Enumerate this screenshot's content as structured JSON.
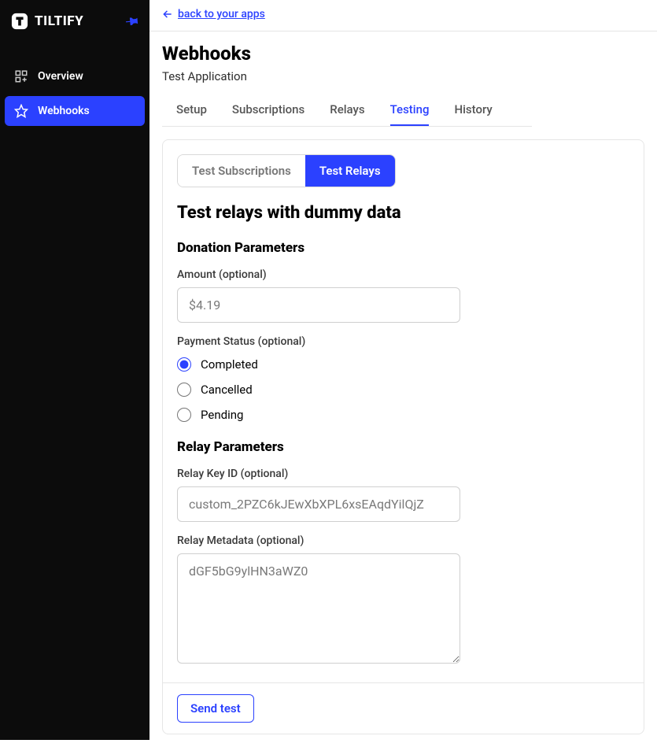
{
  "brand": {
    "name": "TILTIFY"
  },
  "sidebar": {
    "items": [
      {
        "label": "Overview",
        "active": false
      },
      {
        "label": "Webhooks",
        "active": true
      }
    ]
  },
  "backlink": "back to your apps",
  "header": {
    "title": "Webhooks",
    "subtitle": "Test Application"
  },
  "tabs": [
    {
      "label": "Setup",
      "active": false
    },
    {
      "label": "Subscriptions",
      "active": false
    },
    {
      "label": "Relays",
      "active": false
    },
    {
      "label": "Testing",
      "active": true
    },
    {
      "label": "History",
      "active": false
    }
  ],
  "subtabs": [
    {
      "label": "Test Subscriptions",
      "active": false
    },
    {
      "label": "Test Relays",
      "active": true
    }
  ],
  "section_title": "Test relays with dummy data",
  "donation": {
    "group_title": "Donation Parameters",
    "amount_label": "Amount (optional)",
    "amount_placeholder": "$4.19",
    "status_label": "Payment Status (optional)",
    "statuses": [
      {
        "label": "Completed",
        "checked": true
      },
      {
        "label": "Cancelled",
        "checked": false
      },
      {
        "label": "Pending",
        "checked": false
      }
    ]
  },
  "relay": {
    "group_title": "Relay Parameters",
    "keyid_label": "Relay Key ID (optional)",
    "keyid_placeholder": "custom_2PZC6kJEwXbXPL6xsEAqdYilQjZ",
    "metadata_label": "Relay Metadata (optional)",
    "metadata_placeholder": "dGF5bG9ylHN3aWZ0"
  },
  "send_button": "Send test",
  "colors": {
    "accent": "#2b41ff"
  }
}
